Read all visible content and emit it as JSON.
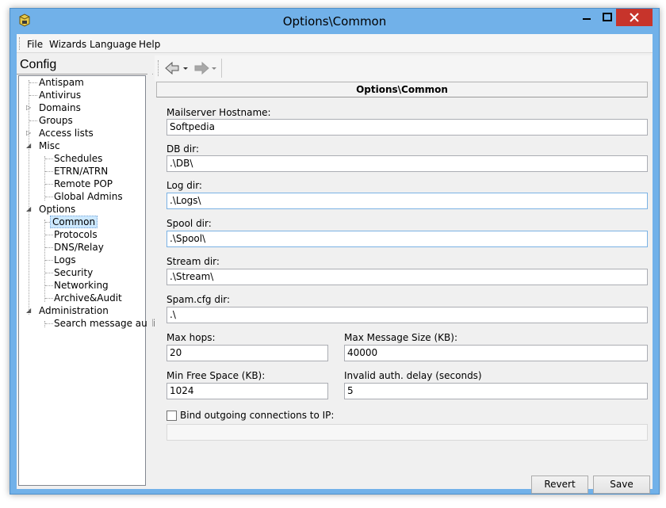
{
  "window": {
    "title": "Options\\Common"
  },
  "menu": [
    "File",
    "Wizards",
    "Language",
    "Help"
  ],
  "config_title": "Config",
  "tree": {
    "antispam": "Antispam",
    "antivirus": "Antivirus",
    "domains": "Domains",
    "groups": "Groups",
    "access_lists": "Access lists",
    "misc": "Misc",
    "schedules": "Schedules",
    "etrn": "ETRN/ATRN",
    "remote_pop": "Remote POP",
    "global_admins": "Global Admins",
    "options": "Options",
    "common": "Common",
    "protocols": "Protocols",
    "dns_relay": "DNS/Relay",
    "logs": "Logs",
    "security": "Security",
    "networking": "Networking",
    "archive_audit": "Archive&Audit",
    "administration": "Administration",
    "search_audit": "Search message audit"
  },
  "panel_title": "Options\\Common",
  "form": {
    "hostname_label": "Mailserver Hostname:",
    "hostname_value": "Softpedia",
    "db_label": "DB dir:",
    "db_value": ".\\DB\\",
    "log_label": "Log dir:",
    "log_value": ".\\Logs\\",
    "spool_label": "Spool dir:",
    "spool_value": ".\\Spool\\",
    "stream_label": "Stream dir:",
    "stream_value": ".\\Stream\\",
    "spamcfg_label": "Spam.cfg dir:",
    "spamcfg_value": ".\\",
    "maxhops_label": "Max hops:",
    "maxhops_value": "20",
    "maxsize_label": "Max Message Size (KB):",
    "maxsize_value": "40000",
    "minfree_label": "Min Free Space (KB):",
    "minfree_value": "1024",
    "authdelay_label": "Invalid auth. delay (seconds)",
    "authdelay_value": "5",
    "bind_label": "Bind outgoing connections to IP:",
    "bind_value": ""
  },
  "buttons": {
    "revert": "Revert",
    "save": "Save"
  }
}
